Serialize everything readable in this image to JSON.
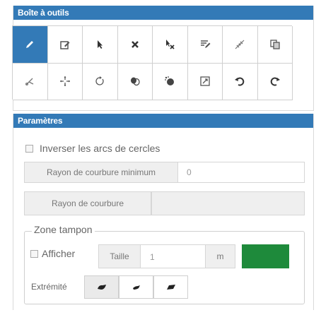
{
  "toolbox": {
    "title": "Boîte à outils",
    "tools": [
      {
        "icon": "pencil-icon",
        "active": true
      },
      {
        "icon": "edit-icon"
      },
      {
        "icon": "cursor-icon"
      },
      {
        "icon": "delete-icon"
      },
      {
        "icon": "select-delete-icon"
      },
      {
        "icon": "annotate-icon"
      },
      {
        "icon": "split-icon"
      },
      {
        "icon": "copy-icon"
      },
      {
        "icon": "cut-icon"
      },
      {
        "icon": "move-icon"
      },
      {
        "icon": "rotate-icon"
      },
      {
        "icon": "merge-icon"
      },
      {
        "icon": "explode-icon"
      },
      {
        "icon": "resize-icon"
      },
      {
        "icon": "undo-icon"
      },
      {
        "icon": "redo-icon"
      }
    ]
  },
  "parameters": {
    "title": "Paramètres",
    "invert_arcs_label": "Inverser les arcs de cercles",
    "min_radius_label": "Rayon de courbure minimum",
    "min_radius_value": "0",
    "radius_label": "Rayon de courbure",
    "radius_value": "",
    "buffer": {
      "legend": "Zone tampon",
      "show_label": "Afficher",
      "size_label": "Taille",
      "size_value": "1",
      "unit": "m",
      "color": "#1e8a3b",
      "end_label": "Extrémité",
      "end_styles": [
        "round-end-icon",
        "flat-end-icon",
        "square-end-icon"
      ]
    }
  }
}
